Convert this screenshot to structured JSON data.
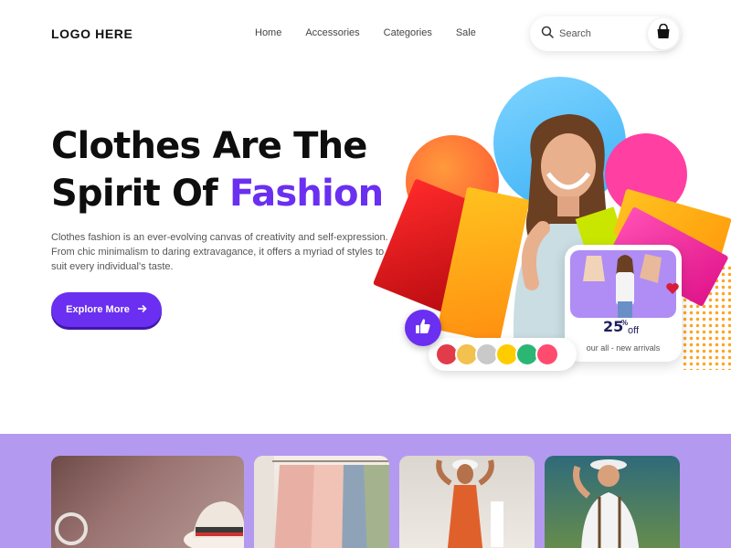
{
  "header": {
    "logo": "LOGO HERE",
    "nav": [
      "Home",
      "Accessories",
      "Categories",
      "Sale"
    ],
    "search_placeholder": "Search"
  },
  "hero": {
    "title_line1": "Clothes Are The",
    "title_line2_prefix": "Spirit Of ",
    "title_accent": "Fashion",
    "description": "Clothes fashion is an ever-evolving canvas of creativity and self-expression. From chic minimalism to daring extravagance, it offers a myriad of styles to suit every individual's taste.",
    "cta_label": "Explore More"
  },
  "promo": {
    "value": "25",
    "sup": "%",
    "off": "off",
    "caption": "our all - new arrivals"
  },
  "colors": {
    "accent": "#6a2ff0",
    "band": "#b499f0",
    "avatar_backgrounds": [
      "#e23b4a",
      "#f2c14e",
      "#c9c9c9",
      "#ffcc00",
      "#2bb673",
      "#ff4b6e"
    ]
  },
  "icons": [
    "search-icon",
    "shopping-bag-icon",
    "arrow-right-icon",
    "thumbs-up-icon",
    "heart-icon"
  ]
}
